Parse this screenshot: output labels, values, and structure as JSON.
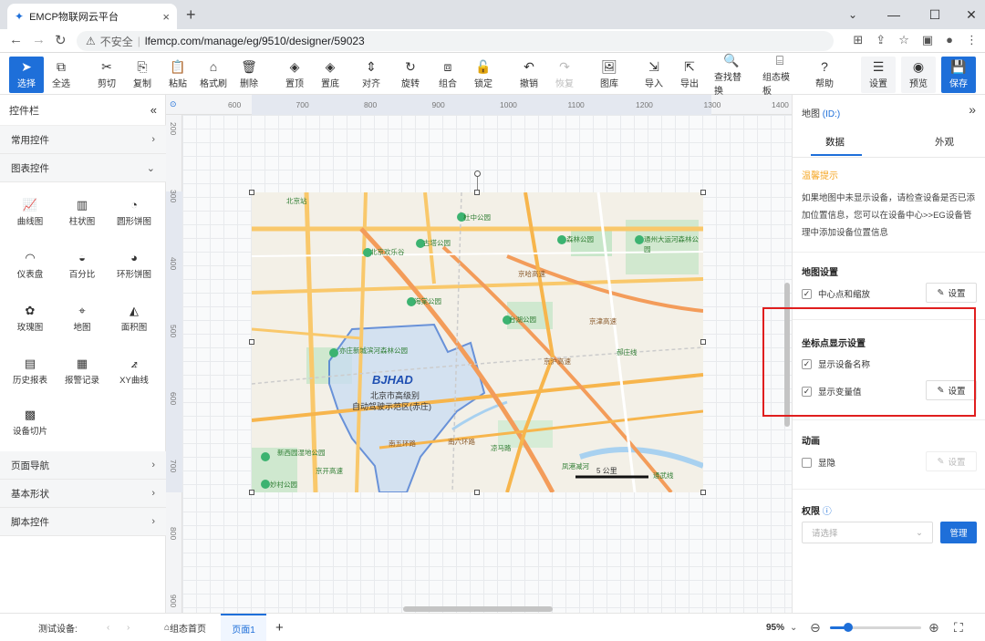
{
  "browser": {
    "tab_title": "EMCP物联网云平台",
    "new_tab": "+",
    "close_tab": "×",
    "win_min": "—",
    "win_max": "☐",
    "win_close": "✕",
    "chevron_down": "⌄",
    "insecure_label": "不安全",
    "url": "lfemcp.com/manage/eg/9510/designer/59023"
  },
  "toolbar": {
    "items": [
      {
        "label": "选择",
        "icon": "➤"
      },
      {
        "label": "全选",
        "icon": "⧉"
      },
      {
        "label": "剪切",
        "icon": "✂"
      },
      {
        "label": "复制",
        "icon": "⎘"
      },
      {
        "label": "粘贴",
        "icon": "📋"
      },
      {
        "label": "格式刷",
        "icon": "⌂"
      },
      {
        "label": "删除",
        "icon": "🗑"
      },
      {
        "label": "置顶",
        "icon": "◈"
      },
      {
        "label": "置底",
        "icon": "◈"
      },
      {
        "label": "对齐",
        "icon": "⇕"
      },
      {
        "label": "旋转",
        "icon": "↻"
      },
      {
        "label": "组合",
        "icon": "⧈"
      },
      {
        "label": "锁定",
        "icon": "🔓"
      },
      {
        "label": "撤销",
        "icon": "↶"
      },
      {
        "label": "恢复",
        "icon": "↷"
      },
      {
        "label": "图库",
        "icon": "🖼"
      },
      {
        "label": "导入",
        "icon": "⇲"
      },
      {
        "label": "导出",
        "icon": "⇱"
      },
      {
        "label": "查找替换",
        "icon": "🔍"
      },
      {
        "label": "组态模板",
        "icon": "⌸"
      },
      {
        "label": "帮助",
        "icon": "?"
      },
      {
        "label": "设置",
        "icon": "☰"
      },
      {
        "label": "预览",
        "icon": "◉"
      },
      {
        "label": "保存",
        "icon": "💾"
      }
    ]
  },
  "left_panel": {
    "title": "控件栏",
    "collapse_icon": "«",
    "categories": [
      {
        "label": "常用控件",
        "arrow": "›"
      },
      {
        "label": "图表控件",
        "arrow": "⌄"
      },
      {
        "label": "页面导航",
        "arrow": "›"
      },
      {
        "label": "基本形状",
        "arrow": "›"
      },
      {
        "label": "脚本控件",
        "arrow": "›"
      }
    ],
    "tiles": [
      {
        "label": "曲线图",
        "icon": "📈"
      },
      {
        "label": "柱状图",
        "icon": "▥"
      },
      {
        "label": "圆形饼图",
        "icon": "◔"
      },
      {
        "label": "仪表盘",
        "icon": "◠"
      },
      {
        "label": "百分比",
        "icon": "◒"
      },
      {
        "label": "环形饼图",
        "icon": "◕"
      },
      {
        "label": "玫瑰图",
        "icon": "✿"
      },
      {
        "label": "地图",
        "icon": "⌖"
      },
      {
        "label": "面积图",
        "icon": "◭"
      },
      {
        "label": "历史报表",
        "icon": "▤"
      },
      {
        "label": "报警记录",
        "icon": "▦"
      },
      {
        "label": "XY曲线",
        "icon": "⦨"
      },
      {
        "label": "设备切片",
        "icon": "▩"
      }
    ]
  },
  "rulers": {
    "top": [
      "600",
      "700",
      "800",
      "900",
      "1000",
      "1100",
      "1200",
      "1300",
      "1400"
    ],
    "left": [
      "200",
      "300",
      "400",
      "500",
      "600",
      "700",
      "800",
      "900"
    ]
  },
  "map": {
    "label_bjhad": "BJHAD",
    "label_area1": "北京市高级别",
    "label_area2": "自动驾驶示范区(赤庄)",
    "labels": [
      "北京站",
      "杜中公园",
      "古塔公园",
      "北京欢乐谷",
      "海棠公园",
      "台湖公园",
      "通州大运河森林公园",
      "森林公园",
      "京哈高速",
      "京津高速",
      "亦庄新城滨河森林公园",
      "南五环路",
      "南六环路",
      "京沪高速",
      "凉马路",
      "凤港减河",
      "通武线",
      "郝庄线",
      "新西园湿地公园",
      "京开高速",
      "妙村公园"
    ],
    "scale": "5 公里"
  },
  "right_panel": {
    "title": "地图",
    "id_label": "(ID:)",
    "expand_icon": "»",
    "tab_data": "数据",
    "tab_appearance": "外观",
    "tip_header": "温馨提示",
    "tip_text": "如果地图中未显示设备，请检查设备是否已添加位置信息，您可以在设备中心>>EG设备管理中添加设备位置信息",
    "map_settings": "地图设置",
    "center_zoom": "中心点和缩放",
    "set": "设置",
    "coord_display": "坐标点显示设置",
    "show_name": "显示设备名称",
    "show_var": "显示变量值",
    "animation": "动画",
    "show_hide": "显隐",
    "permission": "权限",
    "select_placeholder": "请选择",
    "manage": "管理"
  },
  "status_bar": {
    "test_device": "测试设备:",
    "home_page": "组态首页",
    "page1": "页面1",
    "add_page": "+",
    "zoom": "95%",
    "zoom_fraction": 0.2
  }
}
